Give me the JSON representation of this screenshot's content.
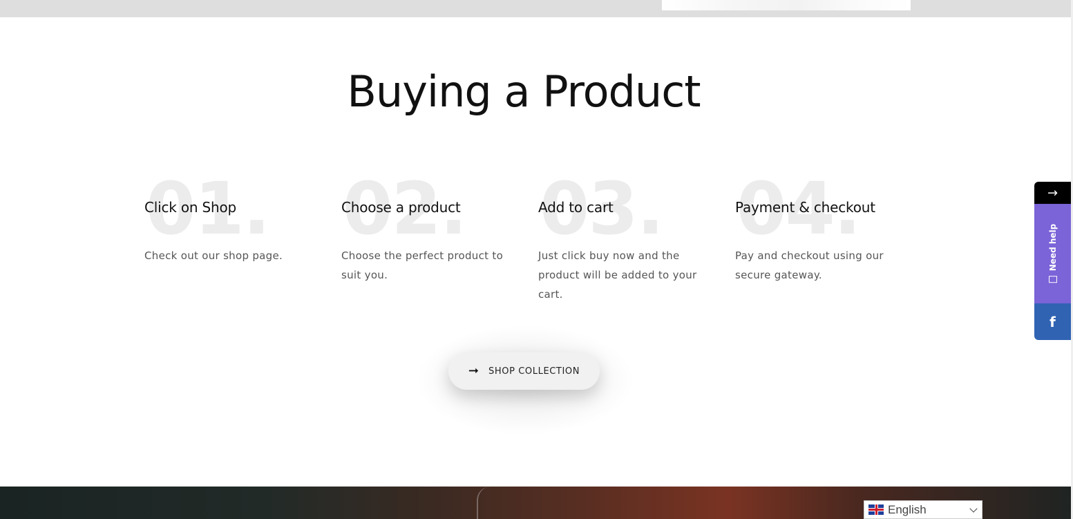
{
  "main": {
    "title": "Buying a Product",
    "steps": [
      {
        "number": "01.",
        "title": "Click on Shop",
        "description": "Check out our shop page."
      },
      {
        "number": "02.",
        "title": "Choose a product",
        "description": "Choose the perfect product to suit you."
      },
      {
        "number": "03.",
        "title": "Add to cart",
        "description": "Just click buy now and the product will be added to your cart."
      },
      {
        "number": "04.",
        "title": "Payment & checkout",
        "description": "Pay and checkout using our secure gateway."
      }
    ],
    "cta": {
      "label": "SHOP COLLECTION",
      "icon": "arrow-right-icon"
    }
  },
  "side_widget": {
    "toggle_glyph": "→",
    "help_label": "Need help",
    "facebook_glyph": "f",
    "colors": {
      "toggle": "#000000",
      "help": "#7b63d8",
      "facebook": "#3163b3"
    }
  },
  "language": {
    "selected": "English",
    "flag": "uk-flag-icon"
  }
}
